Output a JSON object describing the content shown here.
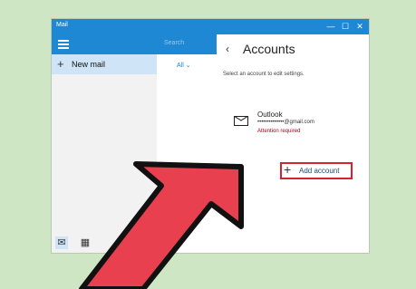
{
  "app": {
    "title": "Mail"
  },
  "window_controls": [
    "—",
    "☐",
    "✕"
  ],
  "nav": {
    "new_mail_label": "New mail",
    "new_mail_icon": "plus-icon"
  },
  "list": {
    "search_placeholder": "Search",
    "filter_label": "All ⌄"
  },
  "accounts": {
    "back": "‹",
    "title": "Accounts",
    "subtitle": "Select an account to edit settings.",
    "items": [
      {
        "name": "Outlook",
        "email": "••••••••••••••@gmail.com",
        "status": "Attention required"
      }
    ],
    "add_account_label": "Add account"
  },
  "bottom_icons": [
    "mail-icon",
    "calendar-icon",
    "smiley-icon",
    "gear-icon"
  ],
  "colors": {
    "accent": "#1e88d4",
    "highlight": "#d4232f",
    "arrow": "#e8404e",
    "background": "#cfe6c4"
  }
}
